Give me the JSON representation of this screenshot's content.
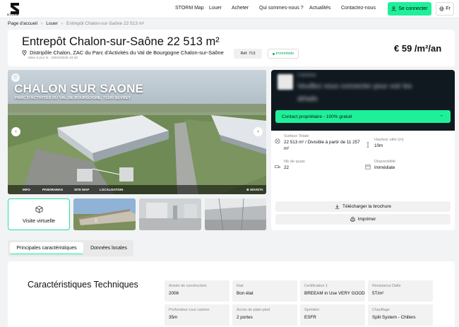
{
  "nav": {
    "brand": "STORM",
    "links": [
      "STORM Map",
      "Louer",
      "Acheter",
      "Qui sommes-nous ?",
      "Actualités",
      "Contactez-nous"
    ],
    "connect_label": "Se connecter",
    "lang_label": "Fr"
  },
  "breadcrumb": {
    "home": "Page d'accueil",
    "louer": "Louer",
    "current": "Entrepôt Chalon-sur-Saône 22 513 m²"
  },
  "listing": {
    "title": "Entrepôt Chalon-sur-Saône 22 513 m²",
    "address": "Distripôle Chalon, ZAC du Parc d'Activités du Val de Bourgogne Chalon-sur-Saône",
    "updated": "Mise à jour le : 29/04/2025 18:48",
    "ref": "Réf. 713",
    "availability": "Immédiate",
    "price": "€ 59 /m²/an"
  },
  "hero": {
    "overlay_title": "CHALON  SUR SAONE",
    "overlay_subtitle": "PARC D'ACTIVITÉS DU VAL DE BOURGOGNE, 71100 SEVREY",
    "bar_items": [
      "INFO",
      "PANORAMAS",
      "SITE MAP",
      "LOCALISATION",
      "⊕ 3DVISTA"
    ]
  },
  "virtual_tour": {
    "label": "Visite virtuelle"
  },
  "contact": {
    "blurred_brand": "Franchise",
    "blurred_text_1": "Veuillez vous connecter pour voir les",
    "blurred_text_2": "détails",
    "button_label": "Contact propriétaire - 100% gratuit"
  },
  "specs": [
    {
      "label": "Surface Totale",
      "value": "22 513 m² / Divisible à partir de 11 257 m²"
    },
    {
      "label": "Hauteur utile (m)",
      "value": "10m"
    },
    {
      "label": "Nb de quais",
      "value": "22"
    },
    {
      "label": "Disponibilité",
      "value": "Immédiate"
    }
  ],
  "actions": {
    "brochure": "Télécharger la brochure",
    "print": "Imprimer"
  },
  "tabs": [
    "Principales caractéristiques",
    "Données locales"
  ],
  "technical": {
    "title": "Caractéristiques Techniques",
    "cells": [
      {
        "label": "Année de construction",
        "value": "2006"
      },
      {
        "label": "Etat",
        "value": "Bon état"
      },
      {
        "label": "Certification 1",
        "value": "BREEAM in Use VERY GOOD"
      },
      {
        "label": "Résistance Dalle",
        "value": "5T/m²"
      },
      {
        "label": "Profondeur cour camion",
        "value": "35m"
      },
      {
        "label": "Accès de plain-pied",
        "value": "2 portes"
      },
      {
        "label": "Sprinkler",
        "value": "ESFR"
      },
      {
        "label": "Chauffage",
        "value": "Split System - Chillers"
      }
    ]
  },
  "colors": {
    "accent": "#1ef09a",
    "dark_panel": "#101820",
    "available": "#1aa860"
  }
}
